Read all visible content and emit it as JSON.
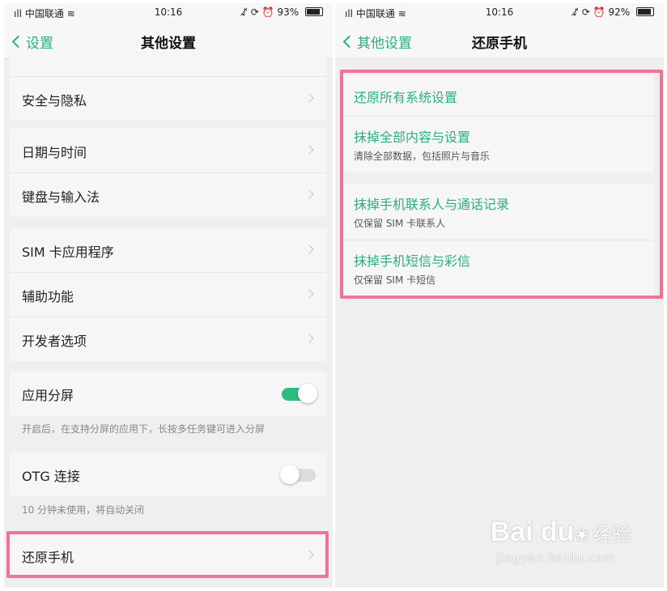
{
  "status_bar": {
    "carrier": "中国联通",
    "time": "10:16",
    "battery_left": "93%",
    "battery_right": "92%"
  },
  "left": {
    "back_label": "设置",
    "title": "其他设置",
    "rows": {
      "security": "安全与隐私",
      "datetime": "日期与时间",
      "keyboard": "键盘与输入法",
      "sim_apps": "SIM 卡应用程序",
      "accessibility": "辅助功能",
      "developer": "开发者选项",
      "split_screen": "应用分屏",
      "otg": "OTG 连接",
      "reset": "还原手机"
    },
    "toggles": {
      "split_screen_on": true,
      "otg_on": false
    },
    "hints": {
      "split_screen": "开启后，在支持分屏的应用下，长按多任务键可进入分屏",
      "otg": "10 分钟未使用，将自动关闭"
    }
  },
  "right": {
    "back_label": "其他设置",
    "title": "还原手机",
    "items": [
      {
        "title": "还原所有系统设置",
        "subtitle": ""
      },
      {
        "title": "抹掉全部内容与设置",
        "subtitle": "清除全部数据，包括照片与音乐"
      },
      {
        "title": "抹掉手机联系人与通话记录",
        "subtitle": "仅保留 SIM 卡联系人"
      },
      {
        "title": "抹掉手机短信与彩信",
        "subtitle": "仅保留 SIM 卡短信"
      }
    ]
  },
  "watermark": {
    "brand": "Bai du",
    "suffix": "经验",
    "url": "jingyan.baidu.com"
  },
  "colors": {
    "accent": "#28b27a",
    "highlight": "#f07297",
    "toggle_on": "#2ebd80"
  }
}
